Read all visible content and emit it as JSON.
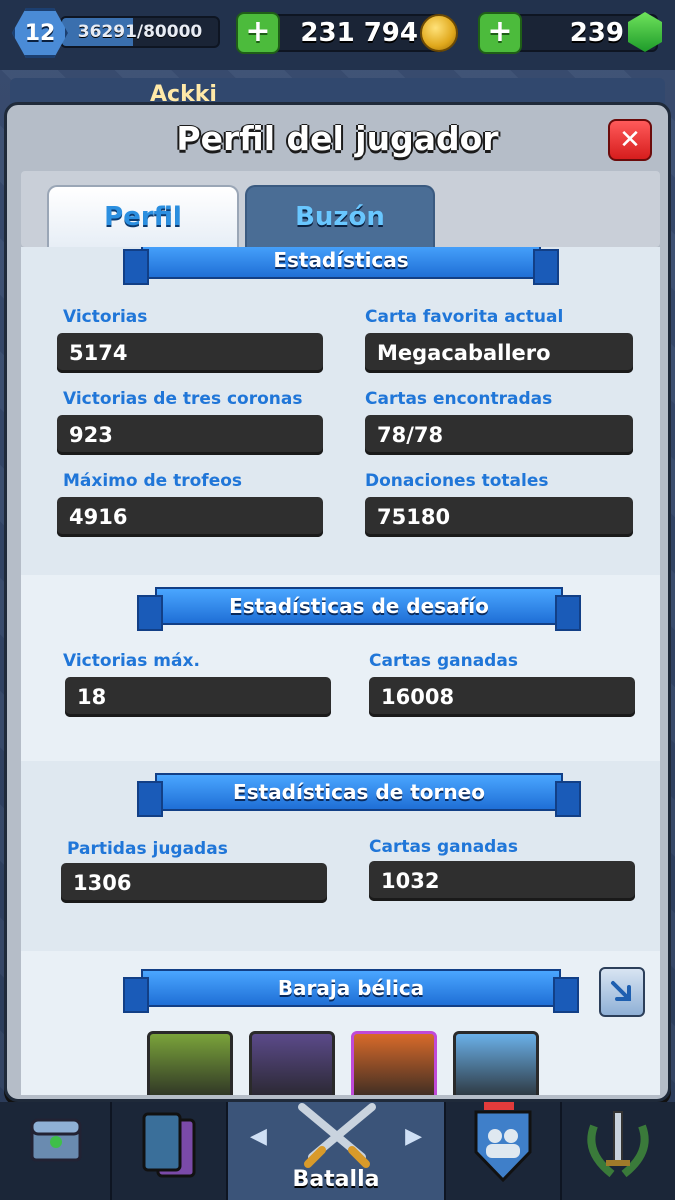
{
  "topbar": {
    "level": "12",
    "xp": "36291/80000",
    "xp_fraction": 0.4536,
    "gold": "231 794",
    "gems": "239"
  },
  "background": {
    "player_name": "Ackki"
  },
  "dialog": {
    "title": "Perfil del jugador",
    "tabs": [
      {
        "label": "Perfil",
        "active": true
      },
      {
        "label": "Buzón",
        "active": false
      }
    ]
  },
  "stats": {
    "ribbon": "Estadísticas",
    "items": [
      {
        "label": "Victorias",
        "value": "5174"
      },
      {
        "label": "Carta favorita actual",
        "value": "Megacaballero"
      },
      {
        "label": "Victorias de tres coronas",
        "value": "923"
      },
      {
        "label": "Cartas encontradas",
        "value": "78/78"
      },
      {
        "label": "Máximo de trofeos",
        "value": "4916"
      },
      {
        "label": "Donaciones totales",
        "value": "75180"
      }
    ]
  },
  "challenge": {
    "ribbon": "Estadísticas de desafío",
    "items": [
      {
        "label": "Victorias máx.",
        "value": "18"
      },
      {
        "label": "Cartas ganadas",
        "value": "16008"
      }
    ]
  },
  "tournament": {
    "ribbon": "Estadísticas de torneo",
    "items": [
      {
        "label": "Partidas jugadas",
        "value": "1306"
      },
      {
        "label": "Cartas ganadas",
        "value": "1032"
      }
    ]
  },
  "deck": {
    "ribbon": "Baraja bélica",
    "cards": [
      {
        "icon": "goblin-card-icon",
        "color": "#7aa33a"
      },
      {
        "icon": "bats-card-icon",
        "color": "#5b4a8a"
      },
      {
        "icon": "graveyard-card-icon",
        "color": "#d86a2a"
      },
      {
        "icon": "zap-card-icon",
        "color": "#6ab0e8"
      }
    ]
  },
  "bottom_nav": {
    "battle_label": "Batalla"
  },
  "colors": {
    "accent_blue": "#2076d8",
    "ribbon_blue": "#1f6fd6",
    "close_red": "#d61d1d",
    "plus_green": "#4cbb3c"
  }
}
